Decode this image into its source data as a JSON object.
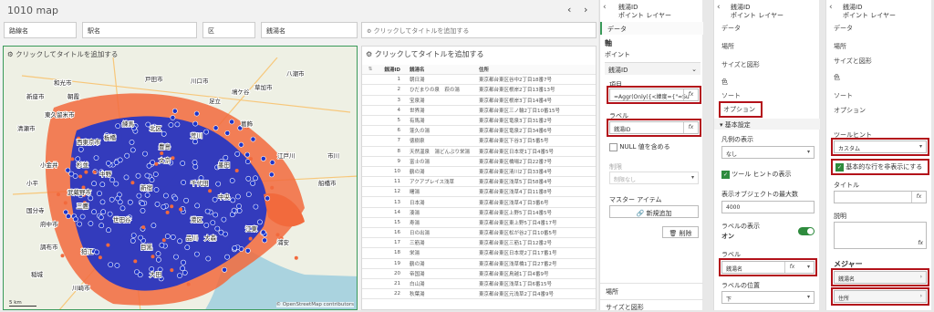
{
  "sheet": {
    "title": "1010 map",
    "nav_prev": "‹",
    "nav_next": "›",
    "filters": [
      "路線名",
      "駅名",
      "区",
      "銭湯名"
    ],
    "add_title_hint": "クリックしてタイトルを追加する"
  },
  "map": {
    "title": "クリックしてタイトルを追加する",
    "attribution": "© OpenStreetMap contributors",
    "scale": "5 km",
    "places": [
      "戸田市",
      "川口市",
      "草加市",
      "八潮市",
      "和光市",
      "鳩ケ谷",
      "足立",
      "新座市",
      "朝霞",
      "練馬",
      "葛飾",
      "東久留米市",
      "板橋",
      "北区",
      "荒川",
      "清瀬市",
      "西東京市",
      "豊島",
      "墨田",
      "小金井",
      "小平",
      "杉並",
      "文京",
      "江戸川",
      "武蔵野市",
      "中野",
      "千代田",
      "船橋市",
      "三鷹",
      "新宿",
      "中央",
      "国分寺",
      "府中市",
      "世田谷",
      "港区",
      "品川",
      "江東",
      "調布市",
      "狛江",
      "目黒",
      "浦安",
      "稲城",
      "大田",
      "川崎市",
      "大森",
      "市川"
    ]
  },
  "table": {
    "title": "クリックしてタイトルを追加する",
    "headers": [
      "銭湯ID",
      "銭湯名",
      "住所"
    ],
    "rows": [
      [
        "1",
        "朝日湯",
        "東京都台東区谷中2丁目18番7号"
      ],
      [
        "2",
        "ひだまりの泉　萩の湯",
        "東京都台東区根岸2丁目13番13号"
      ],
      [
        "3",
        "宝泉湯",
        "東京都台東区根岸3丁目14番4号"
      ],
      [
        "4",
        "世界湯",
        "東京都台東区三ノ輪2丁目10番15号"
      ],
      [
        "5",
        "有馬湯",
        "東京都台東区竜泉3丁目31番2号"
      ],
      [
        "6",
        "蓬久の湯",
        "東京都台東区竜泉2丁目34番6号"
      ],
      [
        "7",
        "徳樹泉",
        "東京都台東区下谷3丁目5番5号"
      ],
      [
        "8",
        "天然温泉　湯どんぶり栄湯",
        "東京都台東区日本堤1丁目4番5号"
      ],
      [
        "9",
        "富士の湯",
        "東京都台東区橋場2丁目22番7号"
      ],
      [
        "10",
        "鶴の湯",
        "東京都台東区清川2丁目33番4号"
      ],
      [
        "11",
        "アクアプレイス浅草",
        "東京都台東区浅草5丁目58番4号"
      ],
      [
        "12",
        "曙湯",
        "東京都台東区浅草4丁目11番8号"
      ],
      [
        "13",
        "日本湯",
        "東京都台東区浅草4丁目3番6号"
      ],
      [
        "14",
        "湊湯",
        "東京都台東区上野5丁目14番5号"
      ],
      [
        "15",
        "寿湯",
        "東京都台東区東上野5丁目4番17号"
      ],
      [
        "16",
        "日の出湯",
        "東京都台東区松が谷2丁目10番5号"
      ],
      [
        "17",
        "三筋湯",
        "東京都台東区三筋1丁目12番2号"
      ],
      [
        "18",
        "栄湯",
        "東京都台東区日本堤2丁目17番1号"
      ],
      [
        "19",
        "鶴の湯",
        "東京都台東区浅草橋1丁目27番2号"
      ],
      [
        "20",
        "帝国湯",
        "東京都台東区鳥越1丁目4番9号"
      ],
      [
        "21",
        "白山湯",
        "東京都台東区浅草1丁目6番15号"
      ],
      [
        "22",
        "秋葉湯",
        "東京都台東区元浅草2丁目4番9号"
      ]
    ]
  },
  "p1": {
    "object": "銭湯ID",
    "type": "ポイント レイヤー",
    "tab": "データ",
    "axis": "軸",
    "point": "ポイント",
    "dim": "銭湯ID",
    "item_label": "項目",
    "item_value": "=Aggr(Only({<緯度={\"=Su",
    "label_label": "ラベル",
    "label_value": "銭湯ID",
    "null_label": "NULL 値を含める",
    "limit_label": "制限",
    "limit_value": "制限なし",
    "master_label": "マスター アイテム",
    "new_btn": "新規追加",
    "delete_btn": "削除",
    "loc": "場所",
    "size": "サイズと図形",
    "fx": "fx"
  },
  "p2": {
    "object": "銭湯ID",
    "type": "ポイント レイヤー",
    "tabs": [
      "データ",
      "場所",
      "サイズと図形",
      "色",
      "ソート",
      "オプション"
    ],
    "basic": "基本設定",
    "legend_label": "凡例の表示",
    "legend_value": "なし",
    "tooltip_show": "ツール ヒントの表示",
    "max_label": "表示オブジェクトの最大数",
    "max_value": "4000",
    "lblshow_label": "ラベルの表示",
    "lblshow_value": "オン",
    "label_label": "ラベル",
    "label_value": "銭湯名",
    "pos_label": "ラベルの位置",
    "pos_value": "下",
    "fx": "fx"
  },
  "p3": {
    "object": "銭湯ID",
    "type": "ポイント レイヤー",
    "tabs": [
      "データ",
      "場所",
      "サイズと図形",
      "色",
      "ソート",
      "オプション"
    ],
    "tooltip": "ツールヒント",
    "tooltip_value": "カスタム",
    "hide_basic": "基本的な行を非表示にする",
    "title_label": "タイトル",
    "desc_label": "説明",
    "measures": "メジャー",
    "m1": "銭湯名",
    "m2": "住所",
    "fx": "fx"
  },
  "colors": {
    "accent_red": "#b3121a",
    "pin_blue": "#1e34c8",
    "area_orange": "#f26a3d",
    "check_green": "#2e8b3d"
  }
}
